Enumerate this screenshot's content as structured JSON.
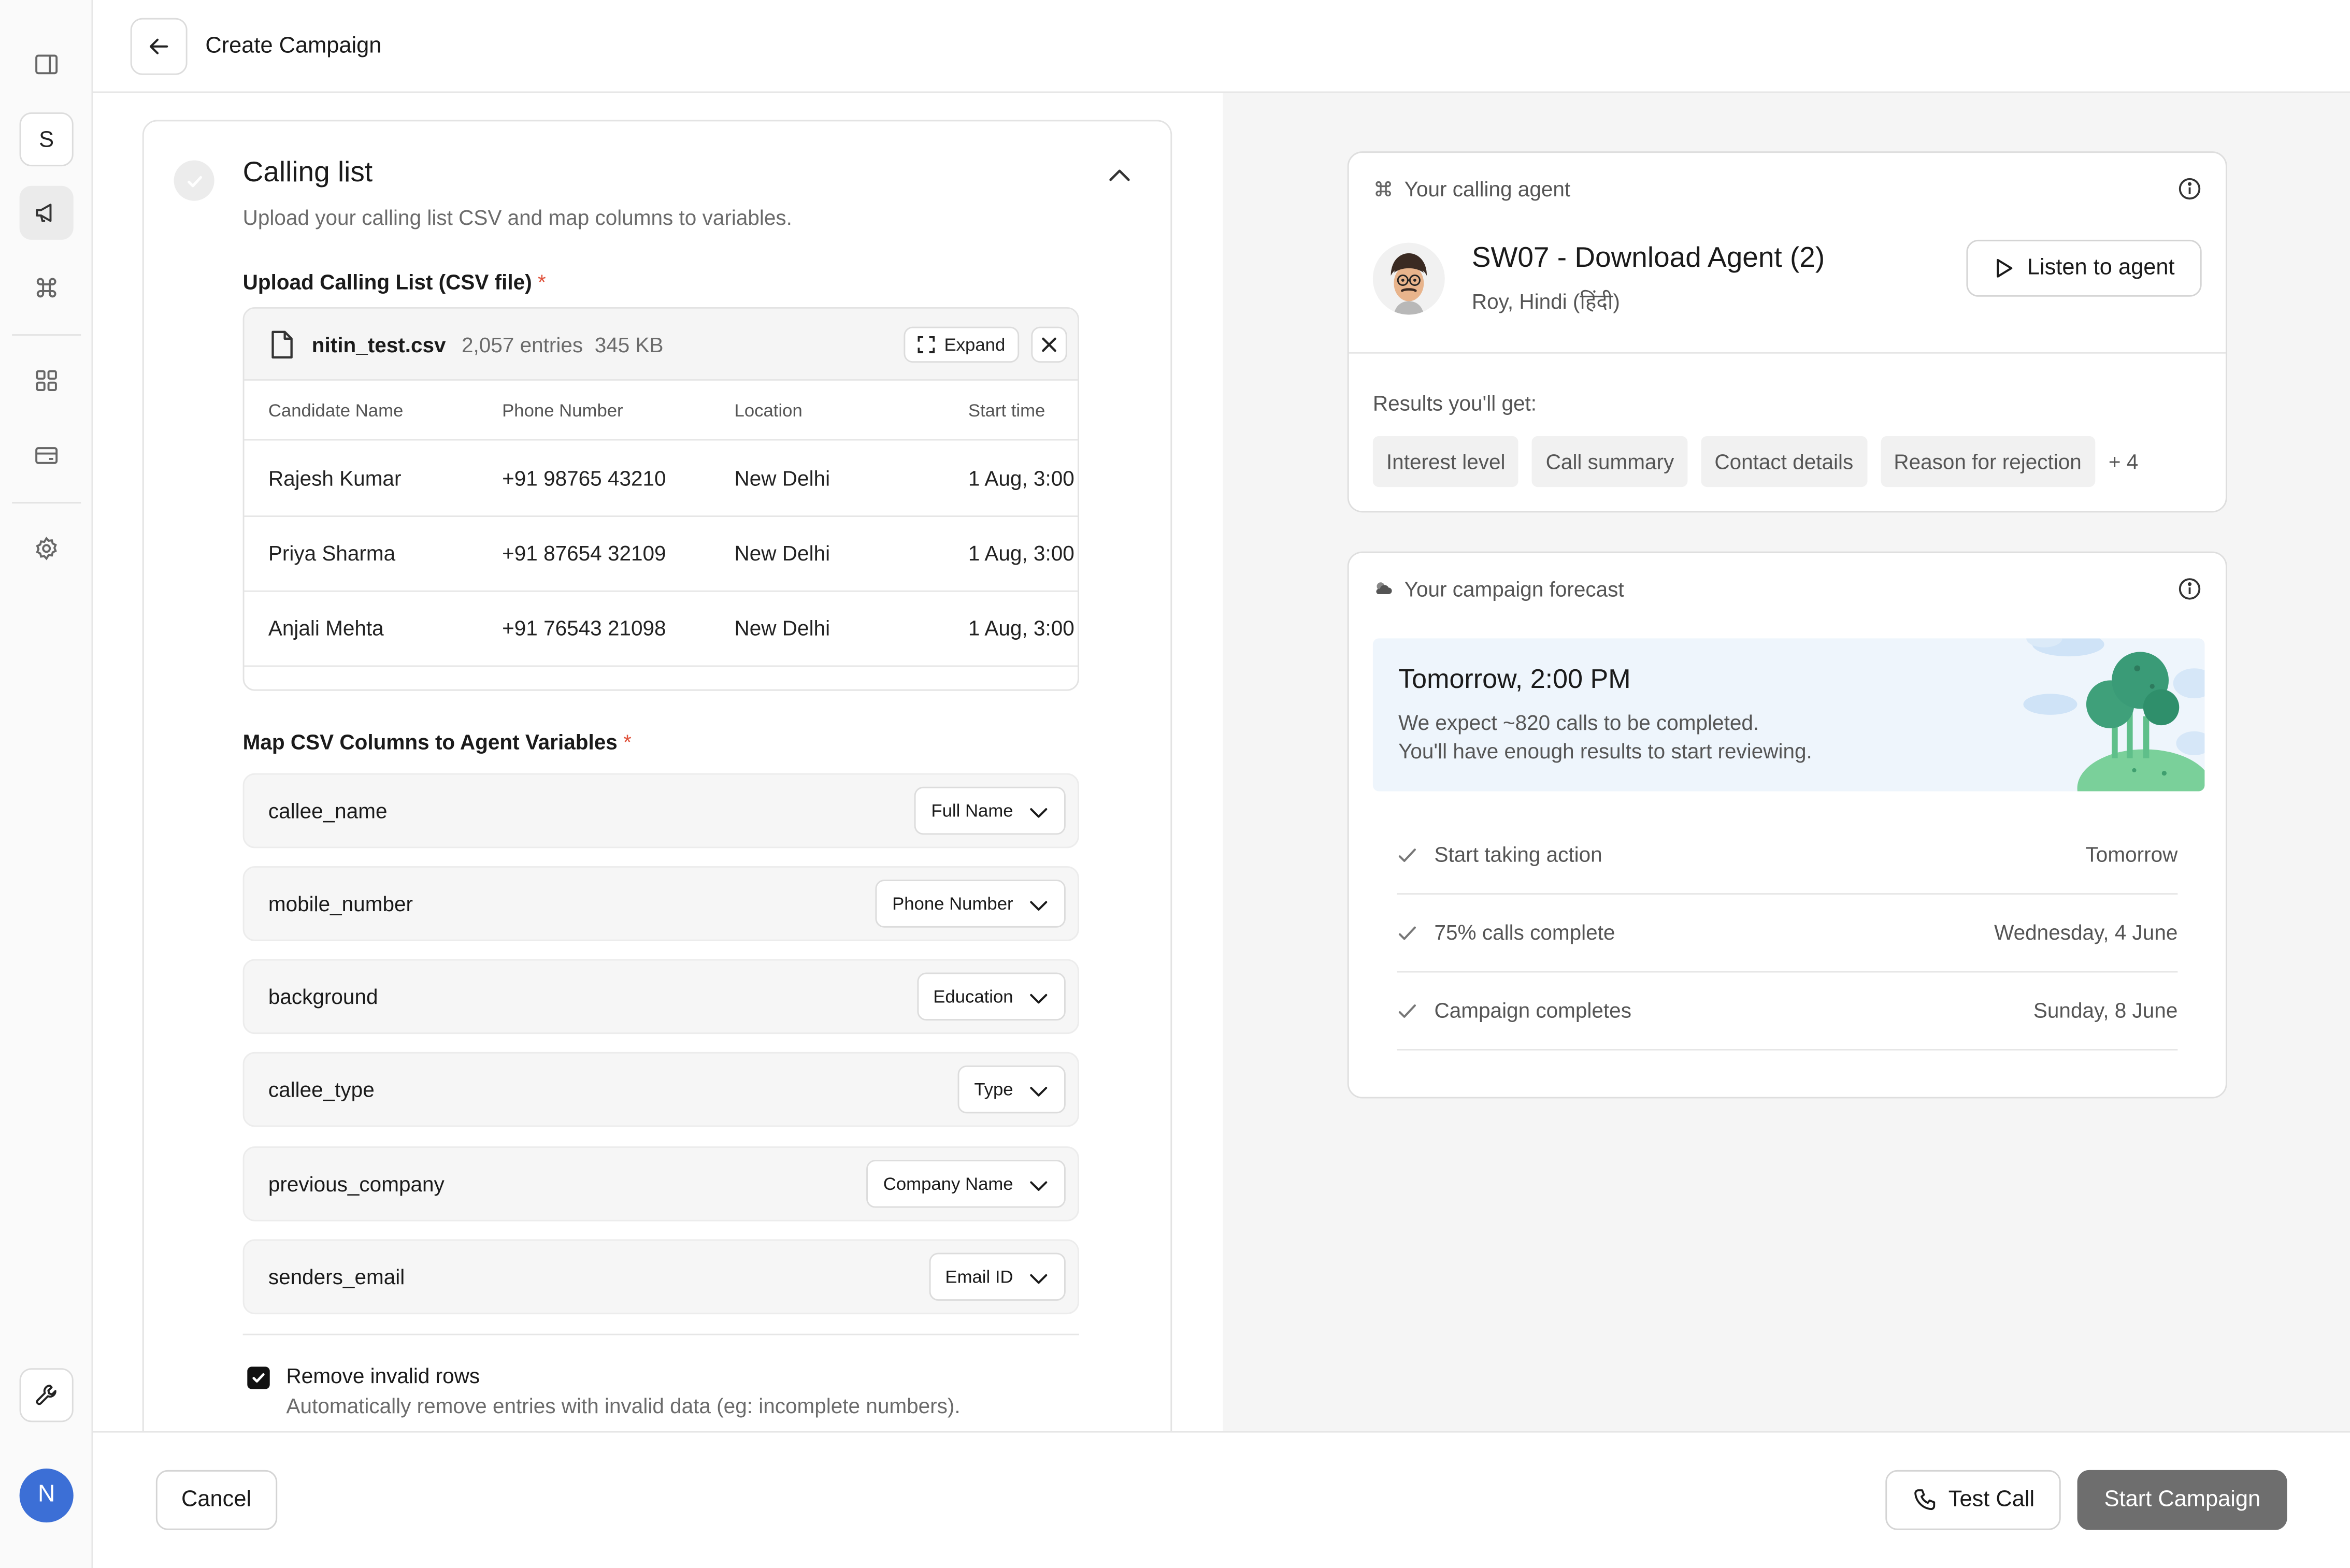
{
  "header": {
    "title": "Create Campaign"
  },
  "rail": {
    "workspace_initial": "S",
    "user_initial": "N"
  },
  "calling_list": {
    "title": "Calling list",
    "subtitle": "Upload your calling list CSV and map columns to variables.",
    "upload_label": "Upload Calling List (CSV file)",
    "required_mark": "*",
    "file": {
      "name": "nitin_test.csv",
      "entries": "2,057 entries",
      "size": "345 KB",
      "expand_label": "Expand"
    },
    "columns": [
      "Candidate Name",
      "Phone Number",
      "Location",
      "Start time"
    ],
    "rows": [
      [
        "Rajesh Kumar",
        "+91 98765 43210",
        "New Delhi",
        "1 Aug, 3:00"
      ],
      [
        "Priya Sharma",
        "+91 87654 32109",
        "New Delhi",
        "1 Aug, 3:00"
      ],
      [
        "Anjali Mehta",
        "+91 76543 21098",
        "New Delhi",
        "1 Aug, 3:00"
      ]
    ],
    "map_label": "Map CSV Columns to Agent Variables",
    "mappings": [
      {
        "variable": "callee_name",
        "column": "Full Name"
      },
      {
        "variable": "mobile_number",
        "column": "Phone Number"
      },
      {
        "variable": "background",
        "column": "Education"
      },
      {
        "variable": "callee_type",
        "column": "Type"
      },
      {
        "variable": "previous_company",
        "column": "Company Name"
      },
      {
        "variable": "senders_email",
        "column": "Email ID"
      }
    ],
    "remove_invalid": {
      "checked": true,
      "title": "Remove invalid rows",
      "description": "Automatically remove entries with invalid data (eg: incomplete numbers)."
    }
  },
  "agent_card": {
    "heading": "Your calling agent",
    "agent_name": "SW07 - Download Agent (2)",
    "agent_meta": "Roy, Hindi (हिंदी)",
    "listen_label": "Listen to agent",
    "results_label": "Results you'll get:",
    "results": [
      "Interest level",
      "Call summary",
      "Contact details",
      "Reason for rejection"
    ],
    "results_more": "+ 4"
  },
  "forecast_card": {
    "heading": "Your campaign forecast",
    "eta": "Tomorrow, 2:00 PM",
    "line1": "We expect ~820 calls to be completed.",
    "line2": "You'll have enough results to start reviewing.",
    "milestones": [
      {
        "label": "Start taking action",
        "date": "Tomorrow"
      },
      {
        "label": "75% calls complete",
        "date": "Wednesday, 4 June"
      },
      {
        "label": "Campaign completes",
        "date": "Sunday, 8 June"
      }
    ]
  },
  "footer": {
    "cancel_label": "Cancel",
    "test_call_label": "Test Call",
    "start_label": "Start Campaign"
  },
  "colors": {
    "accent_avatar": "#3c6fd6",
    "required": "#e0533d",
    "start_button": "#6e6e6e",
    "forecast_bg": "#eef5fc"
  }
}
